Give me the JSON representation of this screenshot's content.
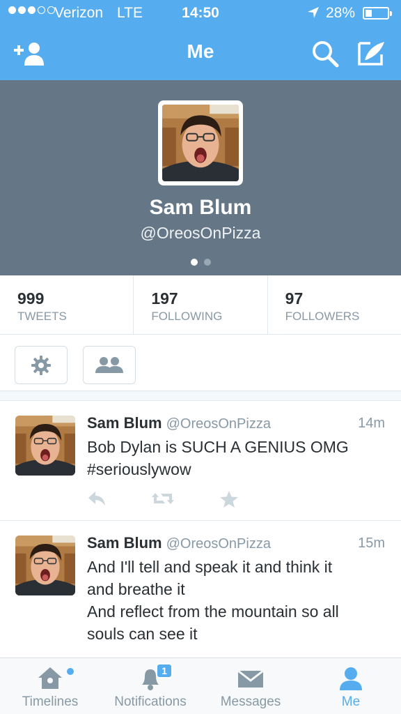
{
  "status_bar": {
    "carrier": "Verizon",
    "network": "LTE",
    "time": "14:50",
    "battery_percent": "28%",
    "signal_bars_filled": 3,
    "signal_bars_total": 5
  },
  "nav": {
    "title": "Me",
    "left_icon": "add-user-icon",
    "right_icons": [
      "search-icon",
      "compose-icon"
    ]
  },
  "profile": {
    "name": "Sam Blum",
    "handle": "@OreosOnPizza",
    "page_indicator": {
      "count": 2,
      "active": 0
    }
  },
  "stats": [
    {
      "value": "999",
      "label": "TWEETS"
    },
    {
      "value": "197",
      "label": "FOLLOWING"
    },
    {
      "value": "97",
      "label": "FOLLOWERS"
    }
  ],
  "action_buttons": [
    "settings-icon",
    "people-icon"
  ],
  "tweets": [
    {
      "name": "Sam Blum",
      "handle": "@OreosOnPizza",
      "time": "14m",
      "lines": [
        "Bob Dylan is SUCH A GENIUS OMG",
        "#seriouslywow"
      ]
    },
    {
      "name": "Sam Blum",
      "handle": "@OreosOnPizza",
      "time": "15m",
      "lines": [
        "And I'll tell and speak it and think it",
        "and breathe it",
        "And reflect from the mountain so all",
        "souls can see it"
      ]
    }
  ],
  "tabs": [
    {
      "label": "Timelines",
      "icon": "home-icon",
      "has_new_dot": true
    },
    {
      "label": "Notifications",
      "icon": "bell-icon",
      "badge": "1"
    },
    {
      "label": "Messages",
      "icon": "envelope-icon"
    },
    {
      "label": "Me",
      "icon": "person-icon",
      "active": true
    }
  ],
  "colors": {
    "brand": "#55acee",
    "header_gray": "#657786",
    "text_dark": "#292f33",
    "text_muted": "#8899a6"
  }
}
